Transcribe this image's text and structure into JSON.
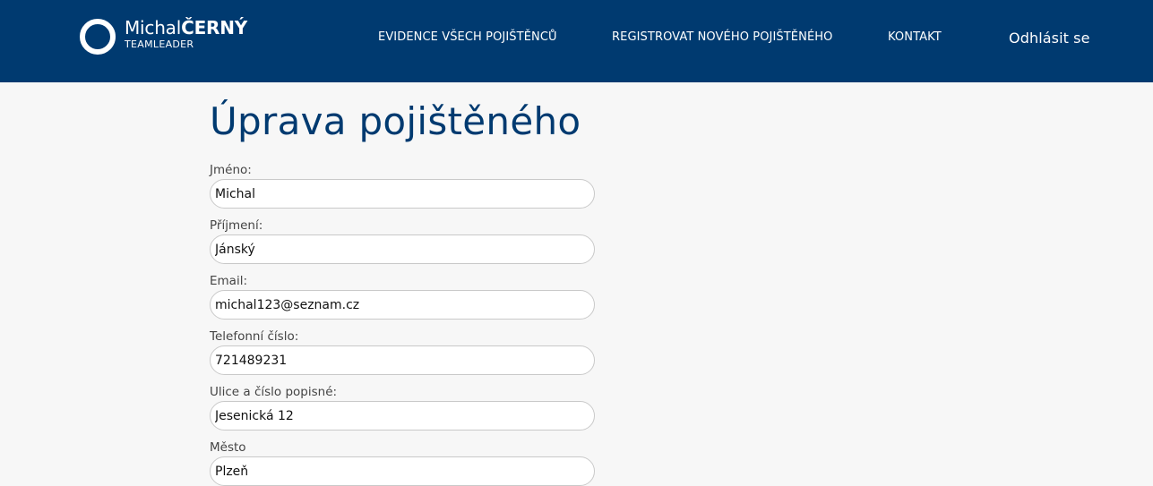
{
  "header": {
    "brand": {
      "first_name": "Michal",
      "last_name": "ČERNÝ",
      "subtitle": "TEAMLEADER",
      "icon": "circle-logo-icon"
    },
    "nav": [
      {
        "label": "EVIDENCE VŠECH POJIŠTĚNCŮ"
      },
      {
        "label": "REGISTROVAT NOVÉHO POJIŠTĚNÉHO"
      },
      {
        "label": "KONTAKT"
      }
    ],
    "logout_label": "Odhlásit se"
  },
  "form": {
    "title": "Úprava pojištěného",
    "fields": [
      {
        "label": "Jméno:",
        "value": "Michal"
      },
      {
        "label": "Příjmení:",
        "value": "Jánský"
      },
      {
        "label": "Email:",
        "value": "michal123@seznam.cz"
      },
      {
        "label": "Telefonní číslo:",
        "value": "721489231"
      },
      {
        "label": "Ulice a číslo popisné:",
        "value": "Jesenická 12"
      },
      {
        "label": "Město",
        "value": "Plzeň"
      }
    ]
  },
  "colors": {
    "header_bg": "#003a70",
    "page_bg": "#f7f7f7",
    "title": "#003a70"
  }
}
